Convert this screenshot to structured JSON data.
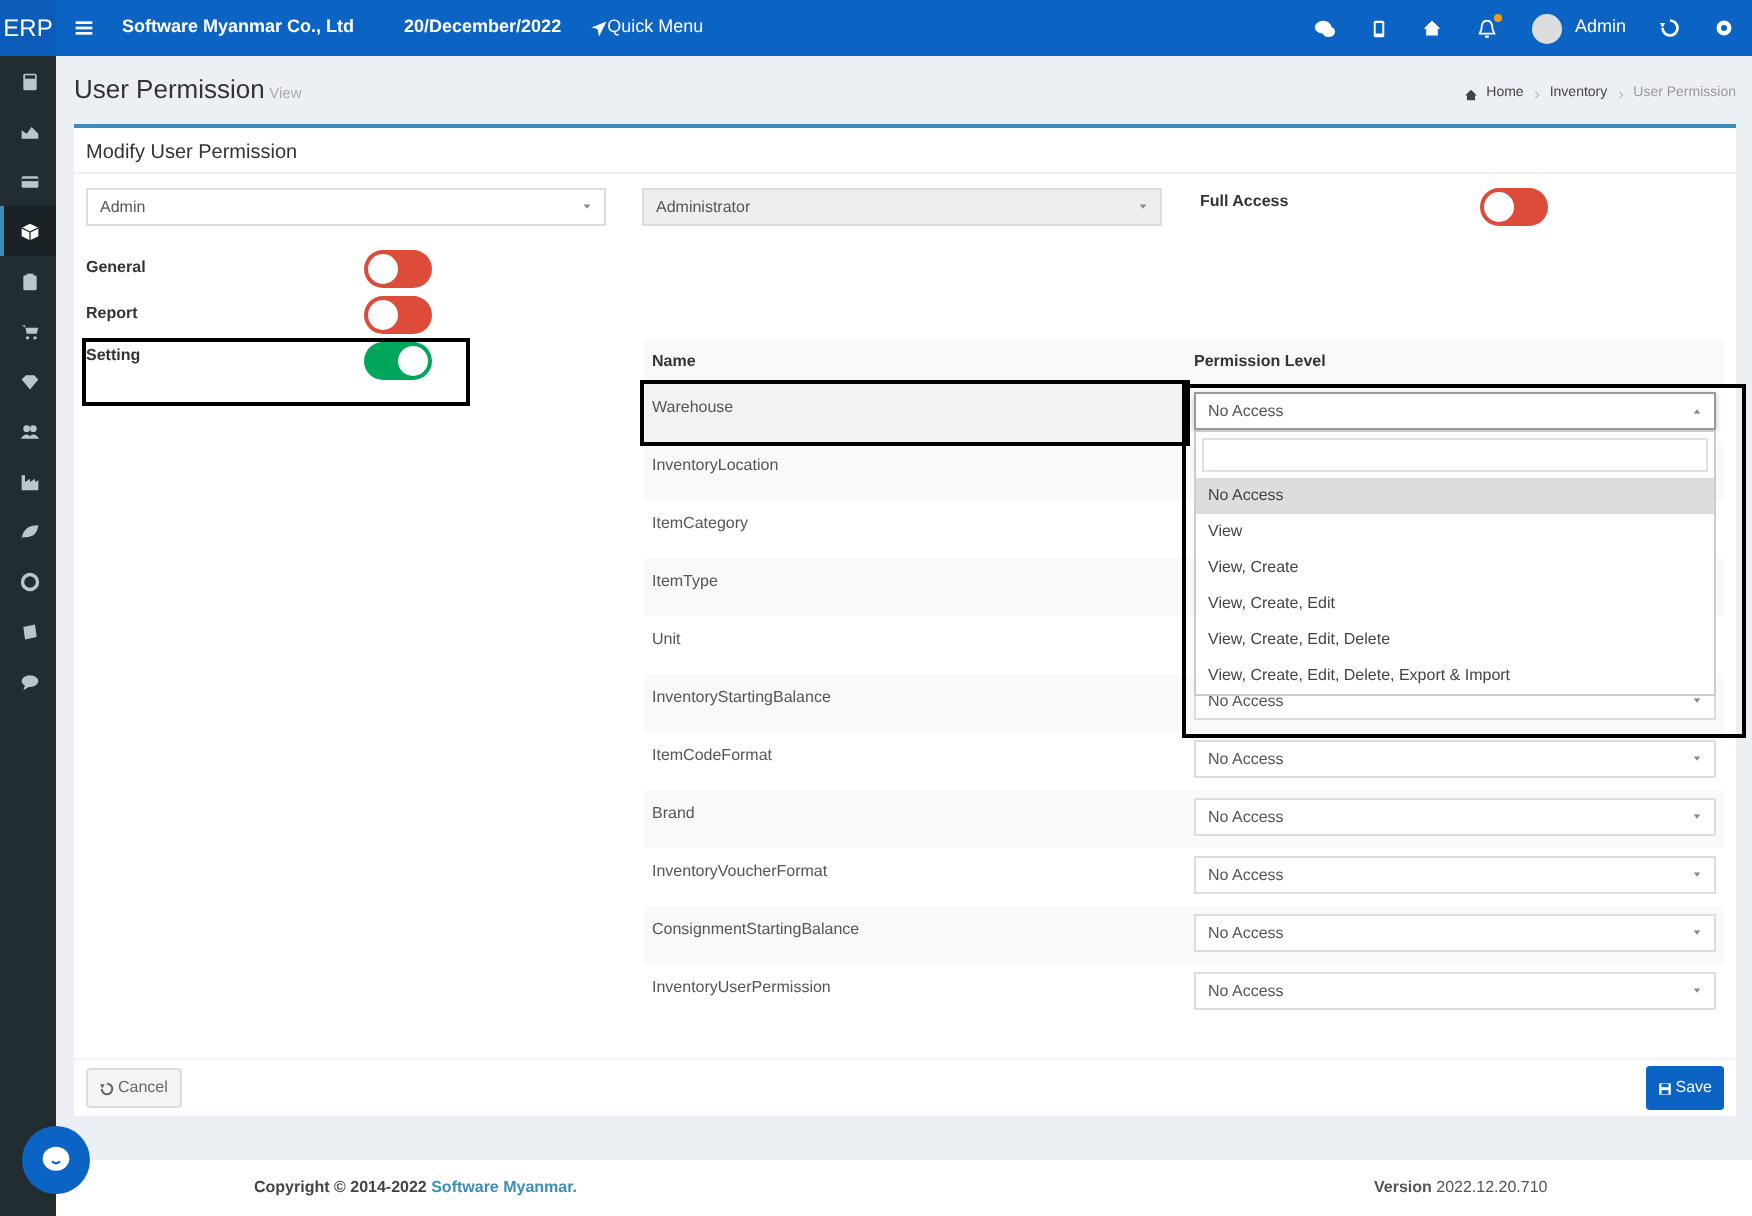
{
  "navbar": {
    "brand": "ERP",
    "company": "Software Myanmar Co., Ltd",
    "date": "20/December/2022",
    "quick_menu": "Quick Menu",
    "notification_dot": true,
    "user": "Admin"
  },
  "sidebar": {
    "items": [
      {
        "selected": false
      },
      {
        "selected": false
      },
      {
        "selected": false
      },
      {
        "selected": true
      },
      {
        "selected": false
      },
      {
        "selected": false
      },
      {
        "selected": false
      },
      {
        "selected": false
      },
      {
        "selected": false
      },
      {
        "selected": false
      },
      {
        "selected": false
      },
      {
        "selected": false
      },
      {
        "selected": false
      }
    ]
  },
  "page": {
    "title": "User Permission",
    "subtitle": "View",
    "breadcrumb": [
      "Home",
      "Inventory",
      "User Permission"
    ]
  },
  "card": {
    "title": "Modify User Permission",
    "user_select": {
      "value": "Admin",
      "disabled": false
    },
    "role_select": {
      "value": "Administrator",
      "disabled": true
    },
    "full_access": {
      "label": "Full Access",
      "on": false
    },
    "modules": [
      {
        "label": "General",
        "on": false,
        "highlighted": false
      },
      {
        "label": "Report",
        "on": false,
        "highlighted": false
      },
      {
        "label": "Setting",
        "on": true,
        "highlighted": true
      }
    ],
    "table": {
      "columns": [
        "Name",
        "Permission Level"
      ],
      "rows": [
        {
          "name": "Warehouse",
          "highlighted": true,
          "permission": "No Access",
          "open": true
        },
        {
          "name": "InventoryLocation",
          "highlighted": false
        },
        {
          "name": "ItemCategory",
          "highlighted": false
        },
        {
          "name": "ItemType",
          "highlighted": false
        },
        {
          "name": "Unit",
          "highlighted": false
        },
        {
          "name": "InventoryStartingBalance",
          "highlighted": false,
          "permission": "No Access",
          "open": false
        },
        {
          "name": "ItemCodeFormat",
          "highlighted": false,
          "permission": "No Access",
          "open": false
        },
        {
          "name": "Brand",
          "highlighted": false,
          "permission": "No Access",
          "open": false
        },
        {
          "name": "InventoryVoucherFormat",
          "highlighted": false,
          "permission": "No Access",
          "open": false
        },
        {
          "name": "ConsignmentStartingBalance",
          "highlighted": false,
          "permission": "No Access",
          "open": false
        },
        {
          "name": "InventoryUserPermission",
          "highlighted": false,
          "permission": "No Access",
          "open": false
        }
      ],
      "dropdown": {
        "highlighted": true,
        "options": [
          {
            "label": "No Access",
            "selected": true
          },
          {
            "label": "View",
            "selected": false
          },
          {
            "label": "View, Create",
            "selected": false
          },
          {
            "label": "View, Create, Edit",
            "selected": false
          },
          {
            "label": "View, Create, Edit, Delete",
            "selected": false
          },
          {
            "label": "View, Create, Edit, Delete, Export & Import",
            "selected": false
          }
        ]
      }
    },
    "buttons": [
      {
        "kind": "cancel",
        "label": "Cancel"
      },
      {
        "kind": "save",
        "label": "Save"
      }
    ]
  },
  "footer": {
    "copyright": "Copyright © 2014-2022",
    "company_link": "Software Myanmar.",
    "version_label": "Version",
    "version": "2022.12.20.710"
  }
}
